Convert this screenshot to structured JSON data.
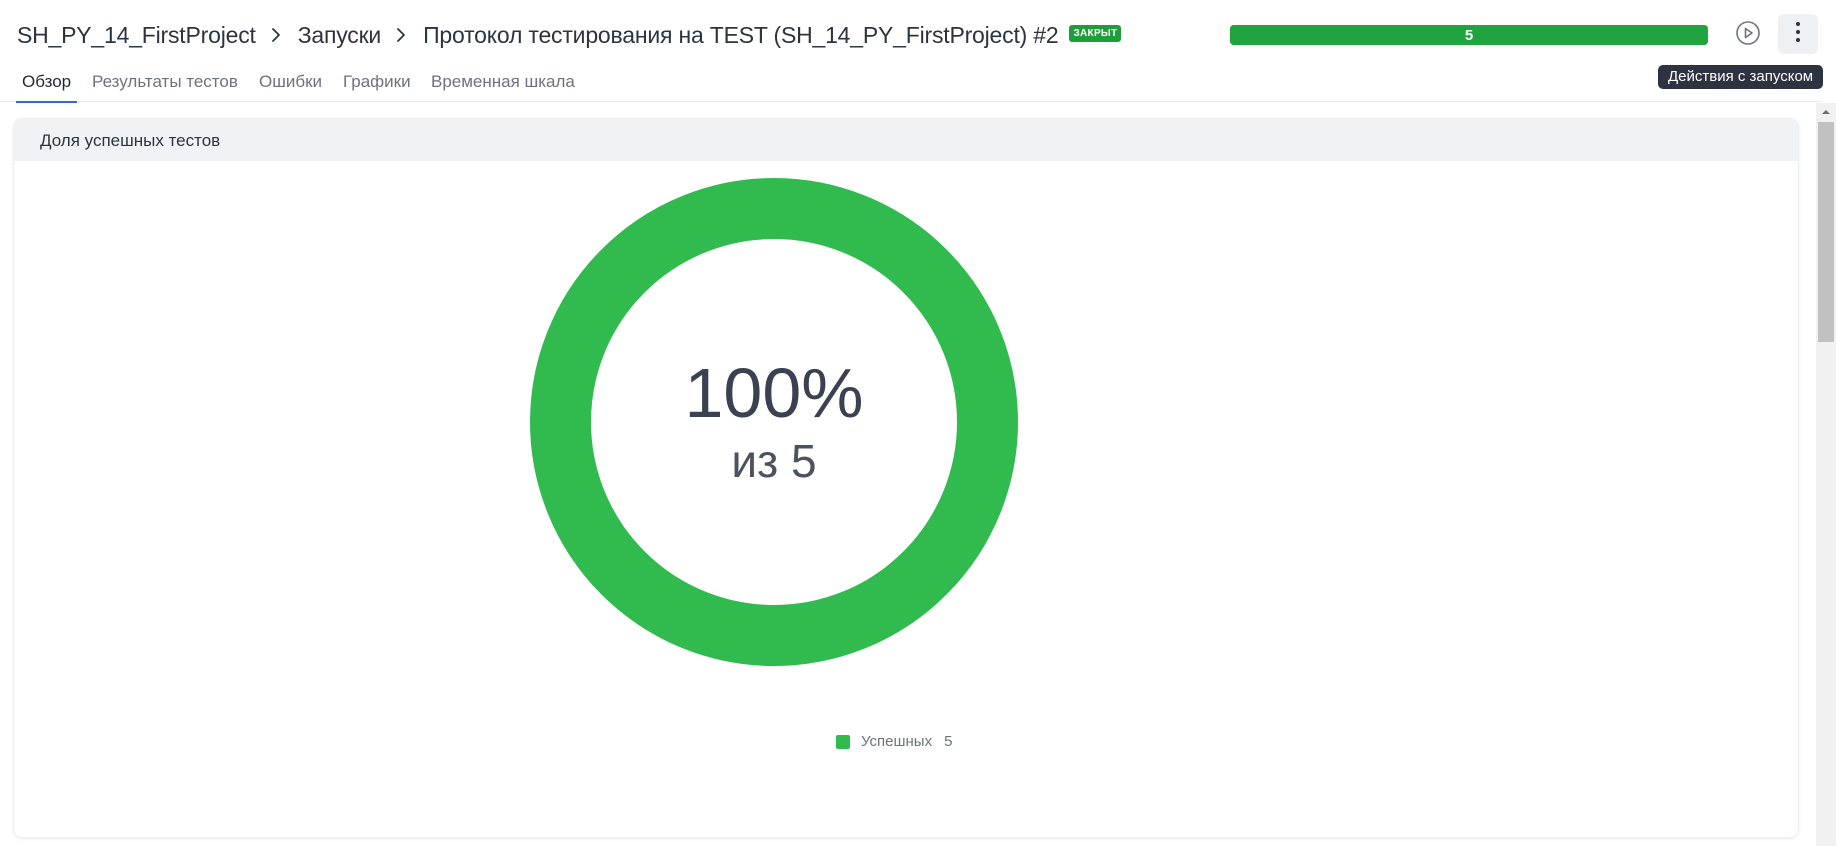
{
  "breadcrumb": {
    "project": "SH_PY_14_FirstProject",
    "launches": "Запуски",
    "run_title": "Протокол тестирования на TEST (SH_14_PY_FirstProject) #2",
    "status_badge": "ЗАКРЫТ"
  },
  "progress": {
    "label": "5",
    "fraction": 1.0,
    "color": "#1fa43f"
  },
  "tabs": [
    {
      "label": "Обзор",
      "active": true
    },
    {
      "label": "Результаты тестов",
      "active": false
    },
    {
      "label": "Ошибки",
      "active": false
    },
    {
      "label": "Графики",
      "active": false
    },
    {
      "label": "Временная шкала",
      "active": false
    }
  ],
  "icons": {
    "run": "play-circle-icon",
    "more": "more-vertical-icon"
  },
  "tooltip": {
    "text": "Действия с запуском"
  },
  "panel": {
    "title": "Доля успешных тестов"
  },
  "chart_data": {
    "type": "pie",
    "style": "donut",
    "center_primary": "100%",
    "center_secondary": "из 5",
    "series": [
      {
        "name": "Успешных",
        "value": 5,
        "color": "#31bb4f"
      }
    ],
    "legend_position": "bottom-center"
  }
}
